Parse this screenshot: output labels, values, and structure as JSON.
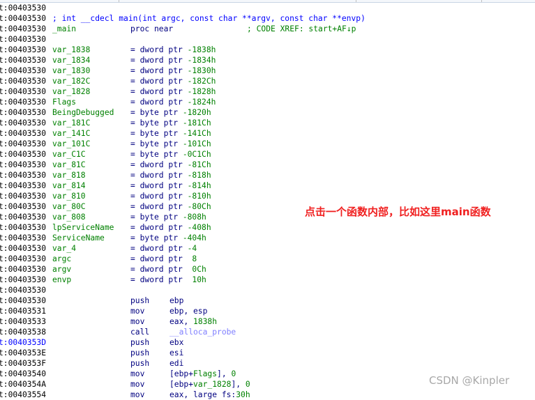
{
  "colors": {
    "address": "#000000",
    "address_highlight": "#0000ff",
    "name": "#008000",
    "mnemonic": "#000080",
    "number": "#008000",
    "comment": "#0000ff",
    "import": "#8080ff",
    "annotation": "#f02020"
  },
  "lines": [
    {
      "addr": "t:00403530"
    },
    {
      "addr": "t:00403530",
      "proto": "; int __cdecl main(int argc, const char **argv, const char **envp)"
    },
    {
      "addr": "t:00403530",
      "label": "_main",
      "op": "proc near",
      "cmt": "; CODE XREF: start+AF↓p"
    },
    {
      "addr": "t:00403530"
    },
    {
      "addr": "t:00403530",
      "label": "var_1838",
      "op": "= dword ptr -1838h"
    },
    {
      "addr": "t:00403530",
      "label": "var_1834",
      "op": "= dword ptr -1834h"
    },
    {
      "addr": "t:00403530",
      "label": "var_1830",
      "op": "= dword ptr -1830h"
    },
    {
      "addr": "t:00403530",
      "label": "var_182C",
      "op": "= dword ptr -182Ch"
    },
    {
      "addr": "t:00403530",
      "label": "var_1828",
      "op": "= dword ptr -1828h"
    },
    {
      "addr": "t:00403530",
      "label": "Flags",
      "op": "= dword ptr -1824h"
    },
    {
      "addr": "t:00403530",
      "label": "BeingDebugged",
      "op": "= byte ptr -1820h"
    },
    {
      "addr": "t:00403530",
      "label": "var_181C",
      "op": "= byte ptr -181Ch"
    },
    {
      "addr": "t:00403530",
      "label": "var_141C",
      "op": "= byte ptr -141Ch"
    },
    {
      "addr": "t:00403530",
      "label": "var_101C",
      "op": "= byte ptr -101Ch"
    },
    {
      "addr": "t:00403530",
      "label": "var_C1C",
      "op": "= byte ptr -0C1Ch"
    },
    {
      "addr": "t:00403530",
      "label": "var_81C",
      "op": "= dword ptr -81Ch"
    },
    {
      "addr": "t:00403530",
      "label": "var_818",
      "op": "= dword ptr -818h"
    },
    {
      "addr": "t:00403530",
      "label": "var_814",
      "op": "= dword ptr -814h"
    },
    {
      "addr": "t:00403530",
      "label": "var_810",
      "op": "= dword ptr -810h"
    },
    {
      "addr": "t:00403530",
      "label": "var_80C",
      "op": "= dword ptr -80Ch"
    },
    {
      "addr": "t:00403530",
      "label": "var_808",
      "op": "= byte ptr -808h"
    },
    {
      "addr": "t:00403530",
      "label": "lpServiceName",
      "op": "= dword ptr -408h"
    },
    {
      "addr": "t:00403530",
      "label": "ServiceName",
      "op": "= byte ptr -404h"
    },
    {
      "addr": "t:00403530",
      "label": "var_4",
      "op": "= dword ptr -4"
    },
    {
      "addr": "t:00403530",
      "label": "argc",
      "op": "= dword ptr  8"
    },
    {
      "addr": "t:00403530",
      "label": "argv",
      "op": "= dword ptr  0Ch"
    },
    {
      "addr": "t:00403530",
      "label": "envp",
      "op": "= dword ptr  10h"
    },
    {
      "addr": "t:00403530"
    },
    {
      "addr": "t:00403530",
      "op": "push",
      "args": [
        {
          "t": "ebp",
          "k": "mnemonic"
        }
      ]
    },
    {
      "addr": "t:00403531",
      "op": "mov",
      "args": [
        {
          "t": "ebp, esp",
          "k": "mnemonic"
        }
      ]
    },
    {
      "addr": "t:00403533",
      "op": "mov",
      "args": [
        {
          "t": "eax, ",
          "k": "mnemonic"
        },
        {
          "t": "1838h",
          "k": "number"
        }
      ]
    },
    {
      "addr": "t:00403538",
      "op": "call",
      "args": [
        {
          "t": "__alloca_probe",
          "k": "import"
        }
      ]
    },
    {
      "addr": "t:0040353D",
      "hl": true,
      "op": "push",
      "args": [
        {
          "t": "ebx",
          "k": "mnemonic"
        }
      ]
    },
    {
      "addr": "t:0040353E",
      "op": "push",
      "args": [
        {
          "t": "esi",
          "k": "mnemonic"
        }
      ]
    },
    {
      "addr": "t:0040353F",
      "op": "push",
      "args": [
        {
          "t": "edi",
          "k": "mnemonic"
        }
      ]
    },
    {
      "addr": "t:00403540",
      "op": "mov",
      "args": [
        {
          "t": "[ebp+",
          "k": "mnemonic"
        },
        {
          "t": "Flags",
          "k": "name"
        },
        {
          "t": "], ",
          "k": "mnemonic"
        },
        {
          "t": "0",
          "k": "number"
        }
      ]
    },
    {
      "addr": "t:0040354A",
      "op": "mov",
      "args": [
        {
          "t": "[ebp+",
          "k": "mnemonic"
        },
        {
          "t": "var_1828",
          "k": "name"
        },
        {
          "t": "], ",
          "k": "mnemonic"
        },
        {
          "t": "0",
          "k": "number"
        }
      ]
    },
    {
      "addr": "t:00403554",
      "op": "mov",
      "args": [
        {
          "t": "eax, large fs:",
          "k": "mnemonic"
        },
        {
          "t": "30h",
          "k": "number"
        }
      ]
    }
  ],
  "annotation": "点击一个函数内部，比如这里main函数",
  "watermark": "CSDN @Kinpler"
}
